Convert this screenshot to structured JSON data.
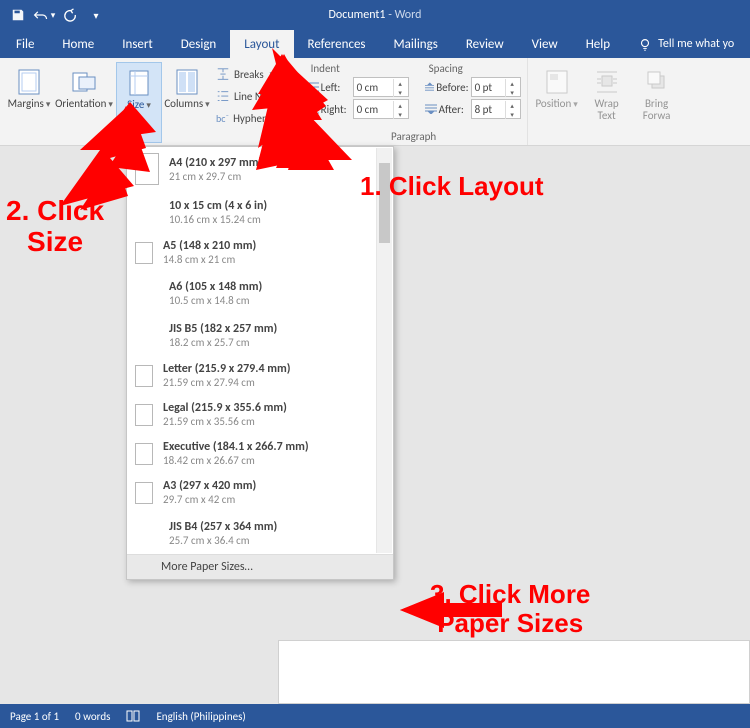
{
  "title": {
    "doc": "Document1",
    "sep": " - ",
    "app": "Word"
  },
  "qat": {
    "save": "save-icon",
    "undo": "undo-icon",
    "redo": "redo-icon",
    "more": "customize-qat-icon"
  },
  "tabs": {
    "file": "File",
    "home": "Home",
    "insert": "Insert",
    "design": "Design",
    "layout": "Layout",
    "references": "References",
    "mailings": "Mailings",
    "review": "Review",
    "view": "View",
    "help": "Help",
    "tellme": "Tell me what yo"
  },
  "ribbon": {
    "page_setup": {
      "margins": "Margins",
      "orientation": "Orientation",
      "size": "Size",
      "columns": "Columns",
      "breaks": "Breaks",
      "line_numbers": "Line Num",
      "hyphenation": "Hyphenation"
    },
    "indent_spacing": {
      "indent_label": "Indent",
      "spacing_label": "Spacing",
      "left_label": "Left:",
      "right_label": "Right:",
      "before_label": "Before:",
      "after_label": "After:",
      "left_val": "0 cm",
      "right_val": "0 cm",
      "before_val": "0 pt",
      "after_val": "8 pt",
      "group_label": "Paragraph"
    },
    "arrange": {
      "position": "Position",
      "wrap_text": "Wrap\nText",
      "bring_forward": "Bring\nForwa"
    }
  },
  "size_menu": {
    "items": [
      {
        "name": "A4 (210 x 297 mm)",
        "dim": "21 cm x 29.7 cm",
        "thumb": "a4"
      },
      {
        "name": "10 x 15 cm (4 x 6 in)",
        "dim": "10.16 cm x 15.24 cm",
        "thumb": "none"
      },
      {
        "name": "A5 (148 x 210 mm)",
        "dim": "14.8 cm x 21 cm",
        "thumb": "small"
      },
      {
        "name": "A6 (105 x 148 mm)",
        "dim": "10.5 cm x 14.8 cm",
        "thumb": "none"
      },
      {
        "name": "JIS B5 (182 x 257 mm)",
        "dim": "18.2 cm x 25.7 cm",
        "thumb": "none"
      },
      {
        "name": "Letter (215.9 x 279.4 mm)",
        "dim": "21.59 cm x 27.94 cm",
        "thumb": "small"
      },
      {
        "name": "Legal (215.9 x 355.6 mm)",
        "dim": "21.59 cm x 35.56 cm",
        "thumb": "small"
      },
      {
        "name": "Executive (184.1 x 266.7 mm)",
        "dim": "18.42 cm x 26.67 cm",
        "thumb": "small"
      },
      {
        "name": "A3 (297 x 420 mm)",
        "dim": "29.7 cm x 42 cm",
        "thumb": "small"
      },
      {
        "name": "JIS B4 (257 x 364 mm)",
        "dim": "25.7 cm x 36.4 cm",
        "thumb": "none"
      }
    ],
    "more": "More Paper Sizes…"
  },
  "status": {
    "page": "Page 1 of 1",
    "words": "0 words",
    "lang": "English (Philippines)"
  },
  "annotations": {
    "a1": "1. Click Layout",
    "a2_line1": "2. Click",
    "a2_line2": "Size",
    "a3_line1": "3. Click More",
    "a3_line2": "Paper Sizes"
  }
}
